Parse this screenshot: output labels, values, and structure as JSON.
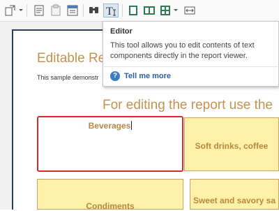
{
  "toolbar": {
    "buttons": [
      {
        "icon": "export-icon"
      },
      {
        "icon": "document-outline-icon"
      },
      {
        "icon": "clipboard-icon"
      },
      {
        "icon": "page-setup-icon"
      },
      {
        "icon": "find-icon"
      },
      {
        "icon": "editor-icon"
      },
      {
        "icon": "single-page-icon"
      },
      {
        "icon": "two-pages-icon"
      },
      {
        "icon": "multiple-pages-icon"
      },
      {
        "icon": "page-width-icon"
      }
    ],
    "active_tool": "editor-icon"
  },
  "tooltip": {
    "title": "Editor",
    "description": "This tool allows you to edit contents of text components directly in the report viewer.",
    "link": "Tell me more",
    "help_glyph": "?"
  },
  "report": {
    "title": "Editable Re",
    "subtitle": "This sample demonstr",
    "heading": "For editing the report use the",
    "cells": [
      {
        "label": "Beverages",
        "editing": true
      },
      {
        "label": "Soft drinks, coffee"
      },
      {
        "label": "Condiments"
      },
      {
        "label": "Sweet and savory sa"
      }
    ]
  },
  "colors": {
    "accent_text": "#c2934c",
    "cell_fill": "#fff1a8",
    "edit_border": "#d42a2a",
    "link": "#2b5f9e"
  }
}
